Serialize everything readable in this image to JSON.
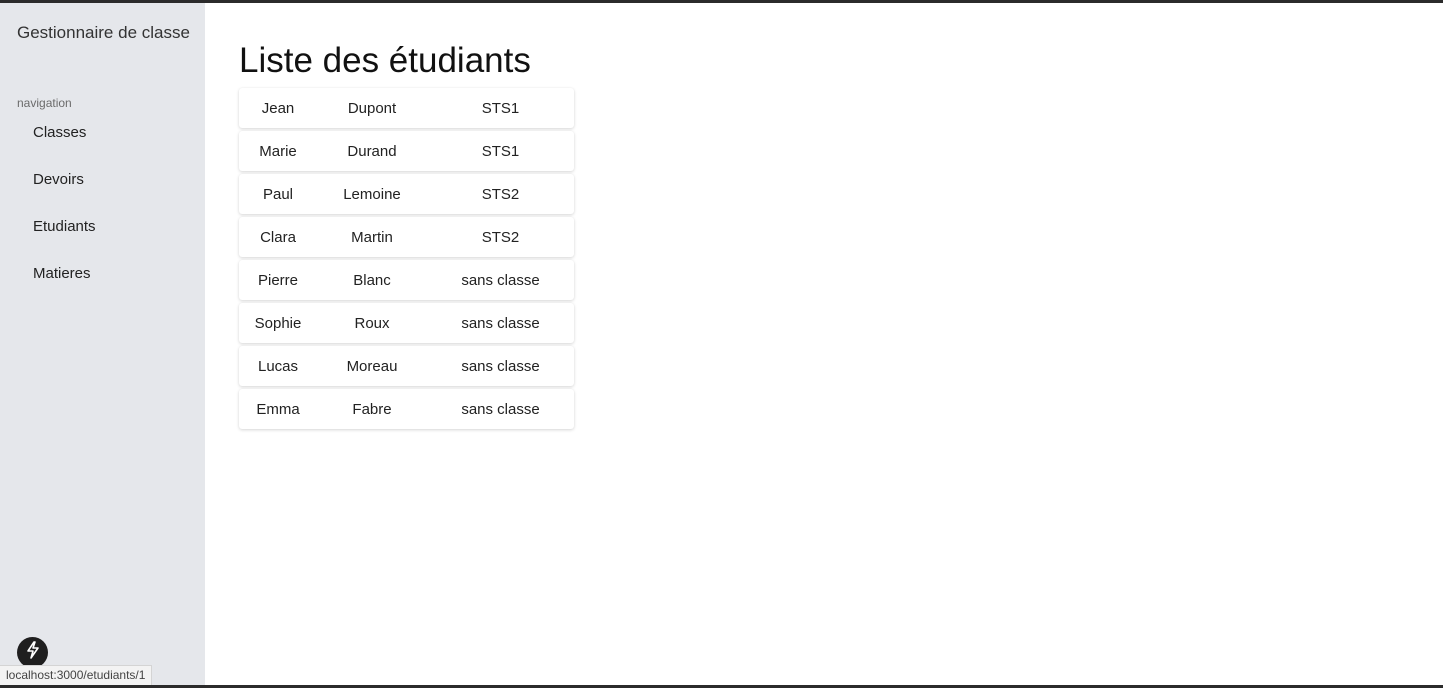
{
  "sidebar": {
    "app_title": "Gestionnaire de classe",
    "nav_heading": "navigation",
    "items": [
      {
        "label": "Classes"
      },
      {
        "label": "Devoirs"
      },
      {
        "label": "Etudiants"
      },
      {
        "label": "Matieres"
      }
    ]
  },
  "main": {
    "title": "Liste des étudiants",
    "students": [
      {
        "first_name": "Jean",
        "last_name": "Dupont",
        "class": "STS1"
      },
      {
        "first_name": "Marie",
        "last_name": "Durand",
        "class": "STS1"
      },
      {
        "first_name": "Paul",
        "last_name": "Lemoine",
        "class": "STS2"
      },
      {
        "first_name": "Clara",
        "last_name": "Martin",
        "class": "STS2"
      },
      {
        "first_name": "Pierre",
        "last_name": "Blanc",
        "class": "sans classe"
      },
      {
        "first_name": "Sophie",
        "last_name": "Roux",
        "class": "sans classe"
      },
      {
        "first_name": "Lucas",
        "last_name": "Moreau",
        "class": "sans classe"
      },
      {
        "first_name": "Emma",
        "last_name": "Fabre",
        "class": "sans classe"
      }
    ]
  },
  "dev_indicator": {
    "icon": "lightning-bolt-icon"
  },
  "status_bar": {
    "url": "localhost:3000/etudiants/1"
  },
  "colors": {
    "sidebar_bg": "#e5e7eb",
    "page_bg": "#ffffff",
    "text": "#222222",
    "badge_bg": "#1f1f1f"
  }
}
